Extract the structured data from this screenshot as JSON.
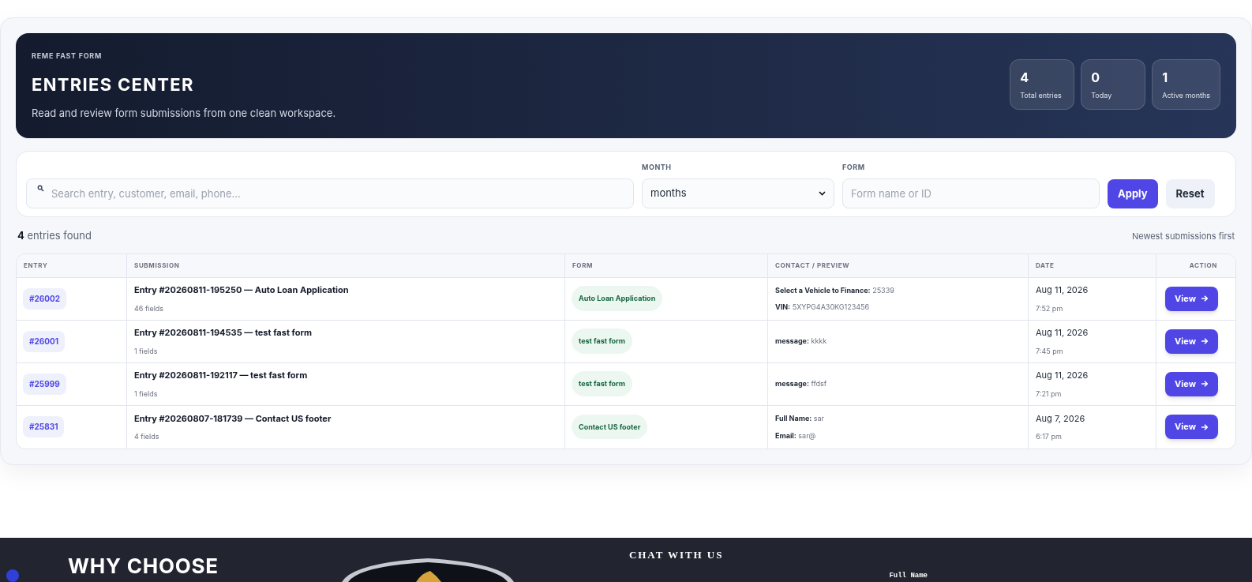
{
  "hero": {
    "eyebrow": "REME FAST FORM",
    "title": "ENTRIES CENTER",
    "subtitle": "Read and review form submissions from one clean workspace.",
    "stats": [
      {
        "value": "4",
        "label": "Total entries"
      },
      {
        "value": "0",
        "label": "Today"
      },
      {
        "value": "1",
        "label": "Active months"
      }
    ]
  },
  "filters": {
    "search": {
      "placeholder": "Search entry, customer, email, phone..."
    },
    "month": {
      "label": "MONTH",
      "value": "months"
    },
    "form": {
      "label": "FORM",
      "placeholder": "Form name or ID"
    },
    "buttons": [
      {
        "kind": "primary",
        "label": "Apply"
      },
      {
        "kind": "secondary",
        "label": "Reset"
      }
    ]
  },
  "summary": {
    "count": "4",
    "text": "entries found",
    "sort": "Newest submissions first"
  },
  "table": {
    "columns": [
      "ENTRY",
      "SUBMISSION",
      "FORM",
      "CONTACT / PREVIEW",
      "DATE",
      "ACTION"
    ],
    "rows": [
      {
        "id": "#26002",
        "title": "Entry #20260811-195250 — Auto Loan Application",
        "fields": "46 fields",
        "form": "Auto Loan Application",
        "preview": [
          {
            "key": "Select a Vehicle to Finance:",
            "value": "25339"
          },
          {
            "key": "VIN:",
            "value": "5XYPG4A30KG123456"
          }
        ],
        "date": "Aug 11, 2026",
        "time": "7:52 pm",
        "action": "View"
      },
      {
        "id": "#26001",
        "title": "Entry #20260811-194535 — test fast form",
        "fields": "1 fields",
        "form": "test fast form",
        "preview": [
          {
            "key": "message:",
            "value": "kkkk"
          }
        ],
        "date": "Aug 11, 2026",
        "time": "7:45 pm",
        "action": "View"
      },
      {
        "id": "#25999",
        "title": "Entry #20260811-192117 — test fast form",
        "fields": "1 fields",
        "form": "test fast form",
        "preview": [
          {
            "key": "message:",
            "value": "ffdsf"
          }
        ],
        "date": "Aug 11, 2026",
        "time": "7:21 pm",
        "action": "View"
      },
      {
        "id": "#25831",
        "title": "Entry #20260807-181739 — Contact US footer",
        "fields": "4 fields",
        "form": "Contact US footer",
        "preview": [
          {
            "key": "Full Name:",
            "value": "sar"
          },
          {
            "key": "Email:",
            "value": "sar@"
          }
        ],
        "date": "Aug 7, 2026",
        "time": "6:17 pm",
        "action": "View"
      }
    ]
  },
  "footer": {
    "heading": "WHY CHOOSE",
    "chat_title": "CHAT WITH US",
    "field_label": "Full Name"
  }
}
